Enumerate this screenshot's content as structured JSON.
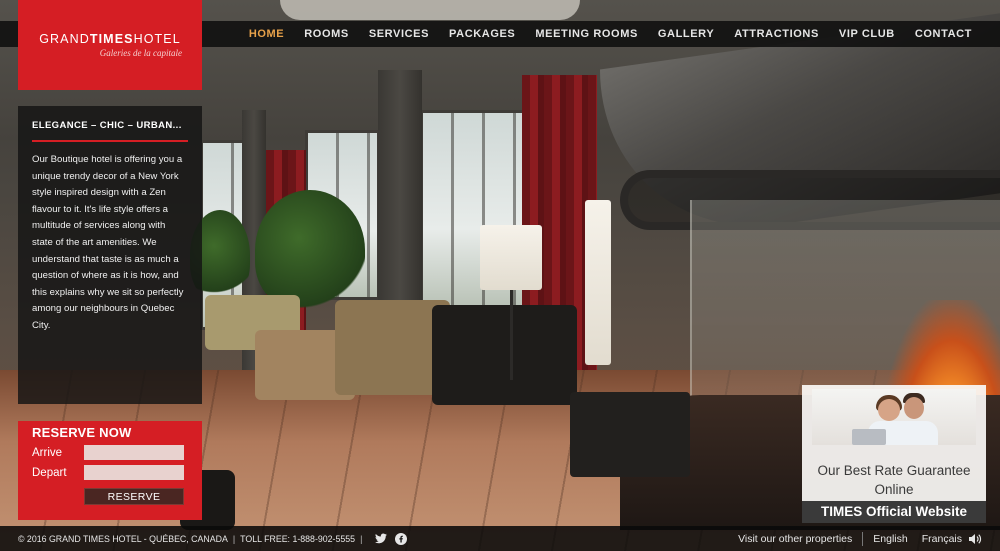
{
  "logo": {
    "brand_plain": "GRAND",
    "brand_bold": "TIMES",
    "brand_tail": "HOTEL",
    "tagline": "Galeries de la capitale"
  },
  "nav": {
    "items": [
      {
        "label": "HOME",
        "active": true
      },
      {
        "label": "ROOMS",
        "active": false
      },
      {
        "label": "SERVICES",
        "active": false
      },
      {
        "label": "PACKAGES",
        "active": false
      },
      {
        "label": "MEETING ROOMS",
        "active": false
      },
      {
        "label": "GALLERY",
        "active": false
      },
      {
        "label": "ATTRACTIONS",
        "active": false
      },
      {
        "label": "VIP CLUB",
        "active": false
      },
      {
        "label": "CONTACT",
        "active": false
      }
    ]
  },
  "intro": {
    "heading": "ELEGANCE – CHIC – URBAN...",
    "body": "Our Boutique hotel is offering you a unique trendy decor of a New York style inspired design with a Zen flavour to it. It's life style offers a multitude of services along with state of the art amenities. We understand that taste is as much a question of where as it is how, and this explains why we sit so perfectly among our neighbours in Quebec City."
  },
  "reserve": {
    "title": "RESERVE NOW",
    "arrive_label": "Arrive",
    "arrive_value": "",
    "depart_label": "Depart",
    "depart_value": "",
    "button_label": "RESERVE"
  },
  "promo": {
    "line1": "Our Best Rate Guarantee",
    "line2": "Online",
    "bar": "TIMES Official Website"
  },
  "footer": {
    "copyright": "© 2016 GRAND TIMES HOTEL - QUÉBEC, CANADA",
    "sep": "|",
    "toll_free": "TOLL FREE: 1-888-902-5555",
    "other_properties": "Visit our other properties",
    "lang_en": "English",
    "lang_fr": "Français"
  },
  "colors": {
    "brand_red": "#d51e24",
    "nav_active": "#e8a24a",
    "bar_dark": "#0a0a0a"
  },
  "icons": {
    "twitter": "twitter-icon",
    "facebook": "facebook-icon",
    "sound": "sound-icon"
  }
}
